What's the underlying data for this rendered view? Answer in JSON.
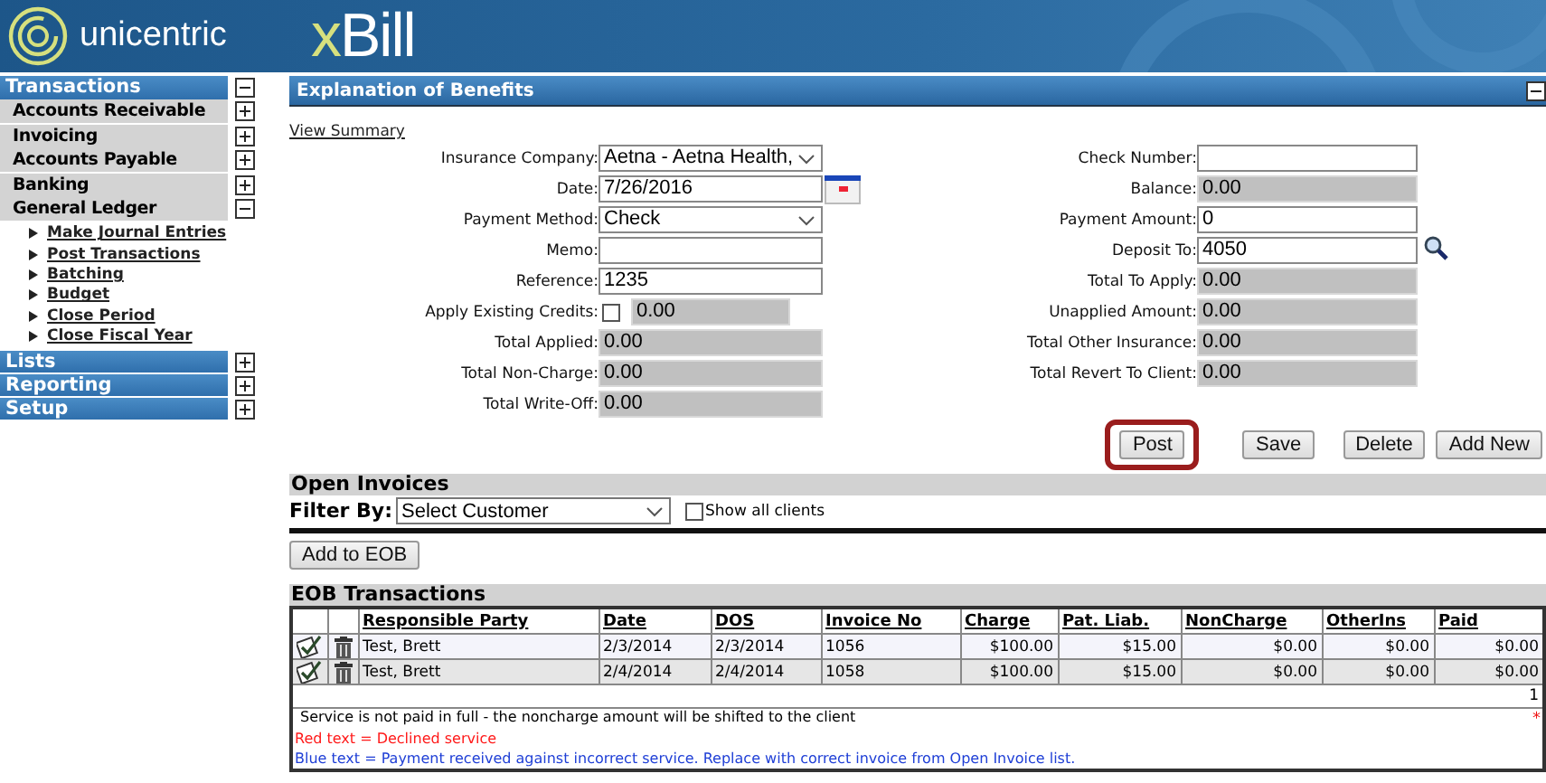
{
  "header": {
    "brand": "unicentric",
    "product": "xBill"
  },
  "sidebar": [
    {
      "label": "Transactions",
      "expanded": true,
      "children": [
        {
          "label": "Accounts Receivable",
          "expanded": false
        },
        {
          "label": "Invoicing",
          "expanded": false
        },
        {
          "label": "Accounts Payable",
          "expanded": false
        },
        {
          "label": "Banking",
          "expanded": false
        },
        {
          "label": "General Ledger",
          "expanded": true,
          "children": [
            {
              "label": "Make Journal Entries"
            },
            {
              "label": "Post Transactions"
            },
            {
              "label": "Batching"
            },
            {
              "label": "Budget"
            },
            {
              "label": "Close Period"
            },
            {
              "label": "Close Fiscal Year"
            }
          ]
        }
      ]
    },
    {
      "label": "Lists",
      "expanded": false
    },
    {
      "label": "Reporting",
      "expanded": false
    },
    {
      "label": "Setup",
      "expanded": false
    }
  ],
  "panel": {
    "title": "Explanation of Benefits",
    "expanded": true,
    "link": "View Summary",
    "left_fields": [
      {
        "label": "Insurance Company:",
        "kind": "select",
        "value": "Aetna - Aetna Health,"
      },
      {
        "label": "Date:",
        "kind": "date",
        "value": "7/26/2016"
      },
      {
        "label": "Payment Method:",
        "kind": "select",
        "value": "Check"
      },
      {
        "label": "Memo:",
        "kind": "input"
      },
      {
        "label": "Reference:",
        "kind": "input",
        "value": "1235"
      },
      {
        "label": "Apply Existing Credits:",
        "kind": "credit",
        "checked": false,
        "value": "0.00"
      },
      {
        "label": "Total Applied:",
        "kind": "readonly",
        "value": "0.00"
      },
      {
        "label": "Total Non-Charge:",
        "kind": "readonly",
        "value": "0.00"
      },
      {
        "label": "Total Write-Off:",
        "kind": "readonly",
        "value": "0.00"
      }
    ],
    "right_fields": [
      {
        "label": "Check Number:",
        "kind": "input"
      },
      {
        "label": "Balance:",
        "kind": "readonly",
        "value": "0.00"
      },
      {
        "label": "Payment Amount:",
        "kind": "input",
        "value": "0"
      },
      {
        "label": "Deposit To:",
        "kind": "lookup",
        "value": "4050"
      },
      {
        "label": "Total To Apply:",
        "kind": "readonly",
        "value": "0.00"
      },
      {
        "label": "Unapplied Amount:",
        "kind": "readonly",
        "value": "0.00"
      },
      {
        "label": "Total Other Insurance:",
        "kind": "readonly",
        "value": "0.00"
      },
      {
        "label": "Total Revert To Client:",
        "kind": "readonly",
        "value": "0.00"
      }
    ],
    "buttons": [
      {
        "label": "Post",
        "highlighted": true
      },
      {
        "label": "Save",
        "highlighted": false
      },
      {
        "label": "Delete",
        "highlighted": false
      },
      {
        "label": "Add New",
        "highlighted": false
      }
    ]
  },
  "open_invoices": {
    "title": "Open Invoices",
    "filter_label": "Filter By:",
    "filter_value": "Select Customer",
    "show_all": {
      "label": "Show all clients",
      "checked": false
    },
    "button": "Add to EOB"
  },
  "eob": {
    "title": "EOB Transactions",
    "columns": [
      "Responsible Party",
      "Date",
      "DOS",
      "Invoice No",
      "Charge",
      "Pat. Liab.",
      "NonCharge",
      "OtherIns",
      "Paid"
    ],
    "rows": [
      {
        "cells": [
          "Test, Brett",
          "2/3/2014",
          "2/3/2014",
          "1056",
          "$100.00",
          "$15.00",
          "$0.00",
          "$0.00",
          "$0.00"
        ]
      },
      {
        "cells": [
          "Test, Brett",
          "2/4/2014",
          "2/4/2014",
          "1058",
          "$100.00",
          "$15.00",
          "$0.00",
          "$0.00",
          "$0.00"
        ]
      }
    ],
    "page": "1",
    "required_mark": "*",
    "notes": [
      {
        "kind": "plain",
        "text": "Service is not paid in full - the noncharge amount will be shifted to the client"
      },
      {
        "kind": "declined",
        "text": "Red text = Declined service"
      },
      {
        "kind": "incorrect",
        "text": "Blue text = Payment received against incorrect service. Replace with correct invoice from Open Invoice list."
      }
    ]
  }
}
